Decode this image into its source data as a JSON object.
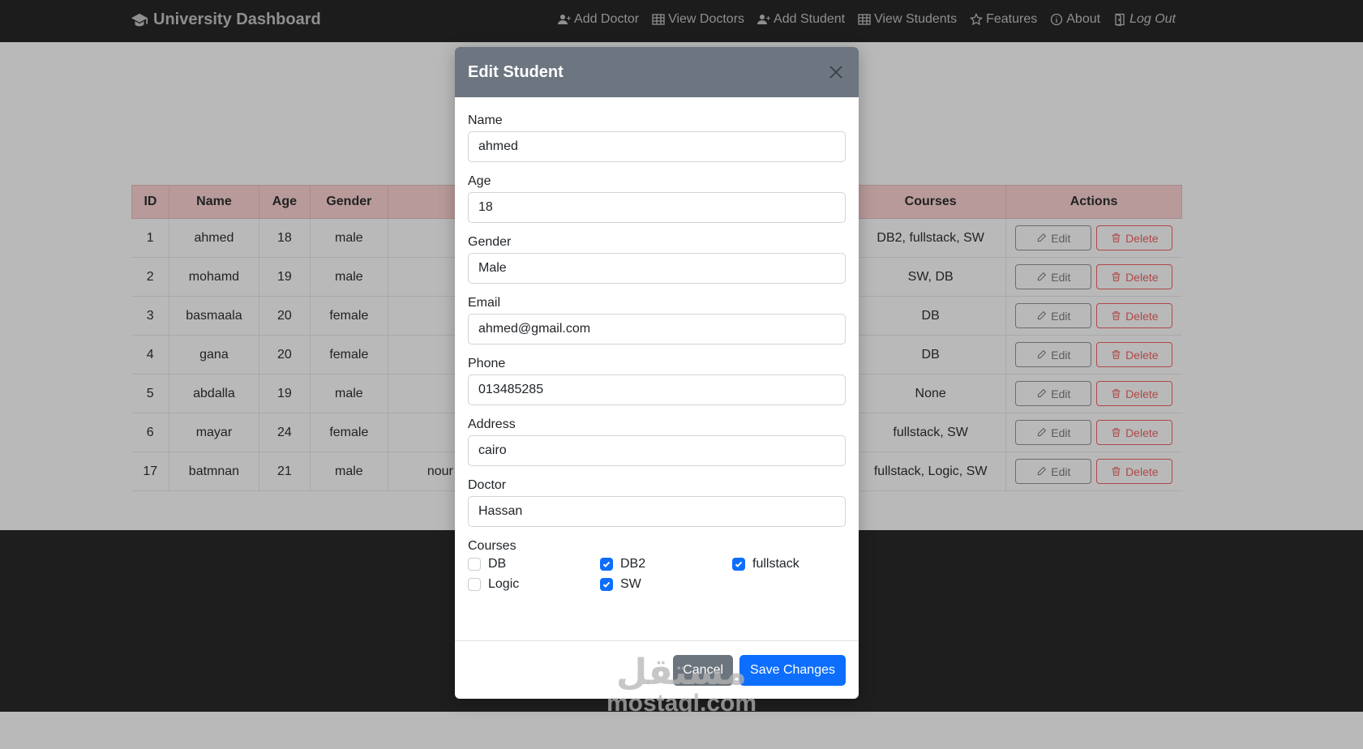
{
  "navbar": {
    "brand": "University Dashboard",
    "links": [
      {
        "label": "Add Doctor",
        "icon": "user-plus-icon"
      },
      {
        "label": "View Doctors",
        "icon": "table-icon"
      },
      {
        "label": "Add Student",
        "icon": "user-plus-icon"
      },
      {
        "label": "View Students",
        "icon": "table-icon"
      },
      {
        "label": "Features",
        "icon": "star-icon"
      },
      {
        "label": "About",
        "icon": "info-icon"
      },
      {
        "label": "Log Out",
        "icon": "door-icon"
      }
    ]
  },
  "table": {
    "headers": [
      "ID",
      "Name",
      "Age",
      "Gender",
      "Courses",
      "Actions"
    ],
    "rows": [
      {
        "id": "1",
        "name": "ahmed",
        "age": "18",
        "gender": "male",
        "hidden": "",
        "courses": "DB2, fullstack, SW"
      },
      {
        "id": "2",
        "name": "mohamd",
        "age": "19",
        "gender": "male",
        "hidden": "",
        "courses": "SW, DB"
      },
      {
        "id": "3",
        "name": "basmaala",
        "age": "20",
        "gender": "female",
        "hidden": "",
        "courses": "DB"
      },
      {
        "id": "4",
        "name": "gana",
        "age": "20",
        "gender": "female",
        "hidden": "",
        "courses": "DB"
      },
      {
        "id": "5",
        "name": "abdalla",
        "age": "19",
        "gender": "male",
        "hidden": "",
        "courses": "None"
      },
      {
        "id": "6",
        "name": "mayar",
        "age": "24",
        "gender": "female",
        "hidden": "",
        "courses": "fullstack, SW"
      },
      {
        "id": "17",
        "name": "batmnan",
        "age": "21",
        "gender": "male",
        "hidden": "nour",
        "courses": "fullstack, Logic, SW"
      }
    ],
    "edit_label": "Edit",
    "delete_label": "Delete"
  },
  "modal": {
    "title": "Edit Student",
    "fields": {
      "name": {
        "label": "Name",
        "value": "ahmed"
      },
      "age": {
        "label": "Age",
        "value": "18"
      },
      "gender": {
        "label": "Gender",
        "value": "Male"
      },
      "email": {
        "label": "Email",
        "value": "ahmed@gmail.com"
      },
      "phone": {
        "label": "Phone",
        "value": "013485285"
      },
      "address": {
        "label": "Address",
        "value": "cairo"
      },
      "doctor": {
        "label": "Doctor",
        "value": "Hassan"
      }
    },
    "courses_label": "Courses",
    "courses": [
      {
        "label": "DB",
        "checked": false
      },
      {
        "label": "DB2",
        "checked": true
      },
      {
        "label": "fullstack",
        "checked": true
      },
      {
        "label": "Logic",
        "checked": false
      },
      {
        "label": "SW",
        "checked": true
      }
    ],
    "cancel_label": "Cancel",
    "save_label": "Save Changes"
  },
  "watermark": {
    "arabic": "مستقل",
    "latin": "mostaql.com"
  },
  "colors": {
    "navbar_bg": "#1c1c1c",
    "page_bg": "#b9b9b9",
    "table_header_bg": "#b89a9a",
    "modal_header_bg": "#6d7580",
    "primary": "#0d6efd",
    "secondary": "#6c757d",
    "danger": "#b04848"
  }
}
